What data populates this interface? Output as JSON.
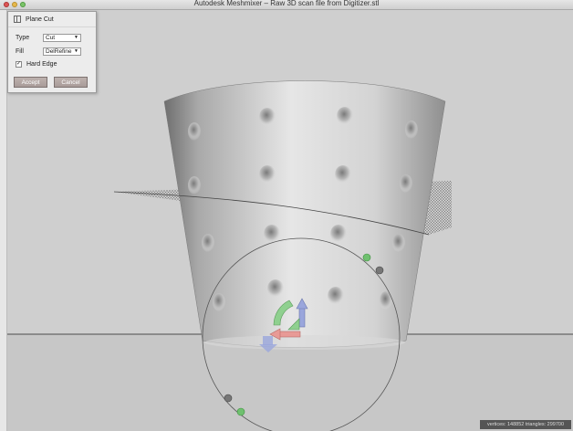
{
  "window": {
    "title": "Autodesk Meshmixer – Raw 3D scan file from Digitizer.stl"
  },
  "panel": {
    "title": "Plane Cut",
    "type_label": "Type",
    "type_value": "Cut",
    "fill_label": "Fill",
    "fill_value": "DelRefine",
    "hard_edge_label": "Hard Edge",
    "hard_edge_checked": true,
    "accept_label": "Accept",
    "cancel_label": "Cancel"
  },
  "status": {
    "text": "vertices: 148852 triangles: 299700"
  },
  "colors": {
    "handle_green": "#8fd08f",
    "handle_blue": "#9aa6dc",
    "handle_red": "#e89a96"
  }
}
